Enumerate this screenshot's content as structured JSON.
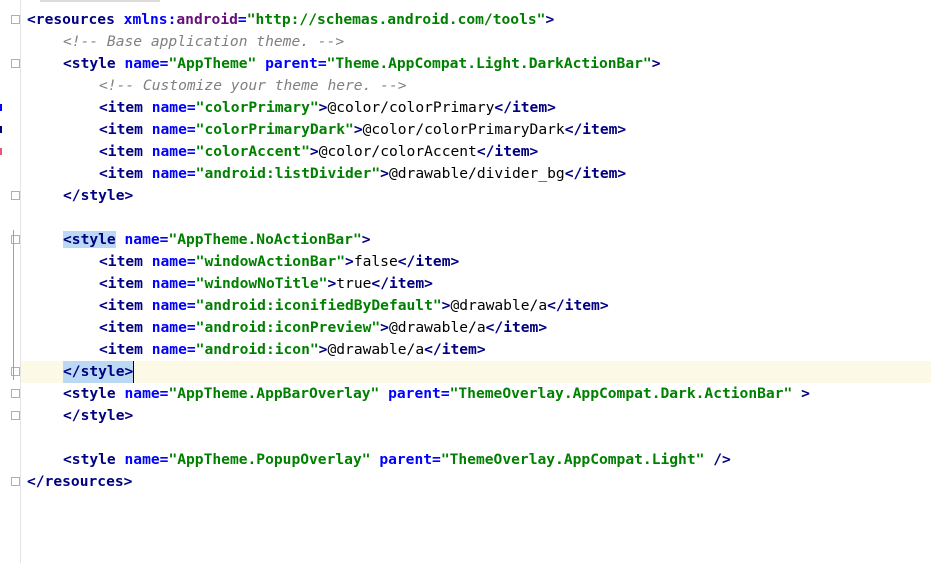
{
  "editor": {
    "language": "xml",
    "colors": {
      "tag": "#000080",
      "attribute": "#0000ff",
      "namespace": "#660e7a",
      "value": "#008000",
      "comment": "#808080",
      "selection": "#bcd9f4",
      "current_line": "#fdf9e7"
    },
    "lines": [
      {
        "t1": "<resources",
        "t2": " xmlns:",
        "t3": "android",
        "t4": "=",
        "t5": "\"http://schemas.android.com/tools\"",
        "t6": ">"
      },
      {
        "comment": "<!-- Base application theme. -->"
      },
      {
        "t1": "<style",
        "a1": " name=",
        "v1": "\"AppTheme\"",
        "a2": " parent=",
        "v2": "\"Theme.AppCompat.Light.DarkActionBar\"",
        "t2": ">"
      },
      {
        "comment": "<!-- Customize your theme here. -->"
      },
      {
        "open": "<item",
        "attr": " name=",
        "val": "\"colorPrimary\"",
        "gt": ">",
        "text": "@color/colorPrimary",
        "close": "</item>"
      },
      {
        "open": "<item",
        "attr": " name=",
        "val": "\"colorPrimaryDark\"",
        "gt": ">",
        "text": "@color/colorPrimaryDark",
        "close": "</item>"
      },
      {
        "open": "<item",
        "attr": " name=",
        "val": "\"colorAccent\"",
        "gt": ">",
        "text": "@color/colorAccent",
        "close": "</item>"
      },
      {
        "open": "<item",
        "attr": " name=",
        "val": "\"android:listDivider\"",
        "gt": ">",
        "text": "@drawable/divider_bg",
        "close": "</item>"
      },
      {
        "close": "</style>"
      },
      {
        "t1": "<style",
        "a1": " name=",
        "v1": "\"AppTheme.NoActionBar\"",
        "t2": ">"
      },
      {
        "open": "<item",
        "attr": " name=",
        "val": "\"windowActionBar\"",
        "gt": ">",
        "text": "false",
        "close": "</item>"
      },
      {
        "open": "<item",
        "attr": " name=",
        "val": "\"windowNoTitle\"",
        "gt": ">",
        "text": "true",
        "close": "</item>"
      },
      {
        "open": "<item",
        "attr": " name=",
        "val": "\"android:iconifiedByDefault\"",
        "gt": ">",
        "text": "@drawable/a",
        "close": "</item>"
      },
      {
        "open": "<item",
        "attr": " name=",
        "val": "\"android:iconPreview\"",
        "gt": ">",
        "text": "@drawable/a",
        "close": "</item>"
      },
      {
        "open": "<item",
        "attr": " name=",
        "val": "\"android:icon\"",
        "gt": ">",
        "text": "@drawable/a",
        "close": "</item>"
      },
      {
        "close": "</style>"
      },
      {
        "t1": "<style",
        "a1": " name=",
        "v1": "\"AppTheme.AppBarOverlay\"",
        "a2": " parent=",
        "v2": "\"ThemeOverlay.AppCompat.Dark.ActionBar\"",
        "t2": " >"
      },
      {
        "close": "</style>"
      },
      {
        "t1": "<style",
        "a1": " name=",
        "v1": "\"AppTheme.PopupOverlay\"",
        "a2": " parent=",
        "v2": "\"ThemeOverlay.AppCompat.Light\"",
        "t2": " />"
      },
      {
        "close": "</resources>"
      }
    ]
  }
}
